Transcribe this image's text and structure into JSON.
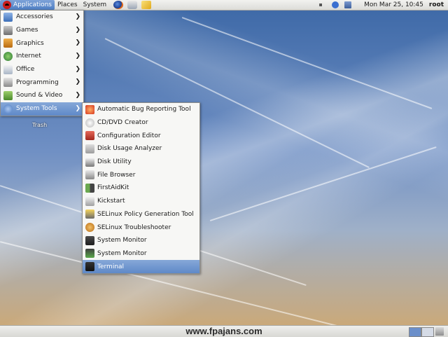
{
  "top_panel": {
    "menus": [
      "Applications",
      "Places",
      "System"
    ],
    "launchers": [
      "firefox-icon",
      "evolution-icon",
      "notes-icon"
    ],
    "clock": "Mon Mar 25, 10:45",
    "user": "root"
  },
  "desktop": {
    "trash_label": "Trash"
  },
  "applications_menu": {
    "items": [
      {
        "label": "Accessories",
        "icon": "accessories-icon"
      },
      {
        "label": "Games",
        "icon": "games-icon"
      },
      {
        "label": "Graphics",
        "icon": "graphics-icon"
      },
      {
        "label": "Internet",
        "icon": "internet-icon"
      },
      {
        "label": "Office",
        "icon": "office-icon"
      },
      {
        "label": "Programming",
        "icon": "programming-icon"
      },
      {
        "label": "Sound & Video",
        "icon": "sound-video-icon"
      },
      {
        "label": "System Tools",
        "icon": "system-tools-icon"
      }
    ],
    "selected": "System Tools"
  },
  "system_tools_menu": {
    "items": [
      {
        "label": "Automatic Bug Reporting Tool",
        "icon": "bug-report-icon"
      },
      {
        "label": "CD/DVD Creator",
        "icon": "disc-icon"
      },
      {
        "label": "Configuration Editor",
        "icon": "config-editor-icon"
      },
      {
        "label": "Disk Usage Analyzer",
        "icon": "disk-usage-icon"
      },
      {
        "label": "Disk Utility",
        "icon": "disk-utility-icon"
      },
      {
        "label": "File Browser",
        "icon": "file-browser-icon"
      },
      {
        "label": "FirstAidKit",
        "icon": "first-aid-icon"
      },
      {
        "label": "Kickstart",
        "icon": "kickstart-icon"
      },
      {
        "label": "SELinux Policy Generation Tool",
        "icon": "selinux-policy-icon"
      },
      {
        "label": "SELinux Troubleshooter",
        "icon": "selinux-troubleshooter-icon"
      },
      {
        "label": "System Monitor",
        "icon": "system-monitor-icon"
      },
      {
        "label": "System Monitor",
        "icon": "system-monitor-icon"
      },
      {
        "label": "Terminal",
        "icon": "terminal-icon"
      }
    ],
    "highlighted": "Terminal"
  },
  "bottom_panel": {
    "watermark": "www.fpajans.com"
  },
  "colors": {
    "menu_highlight": "#5f89c8",
    "panel": "#dcdcd8"
  }
}
